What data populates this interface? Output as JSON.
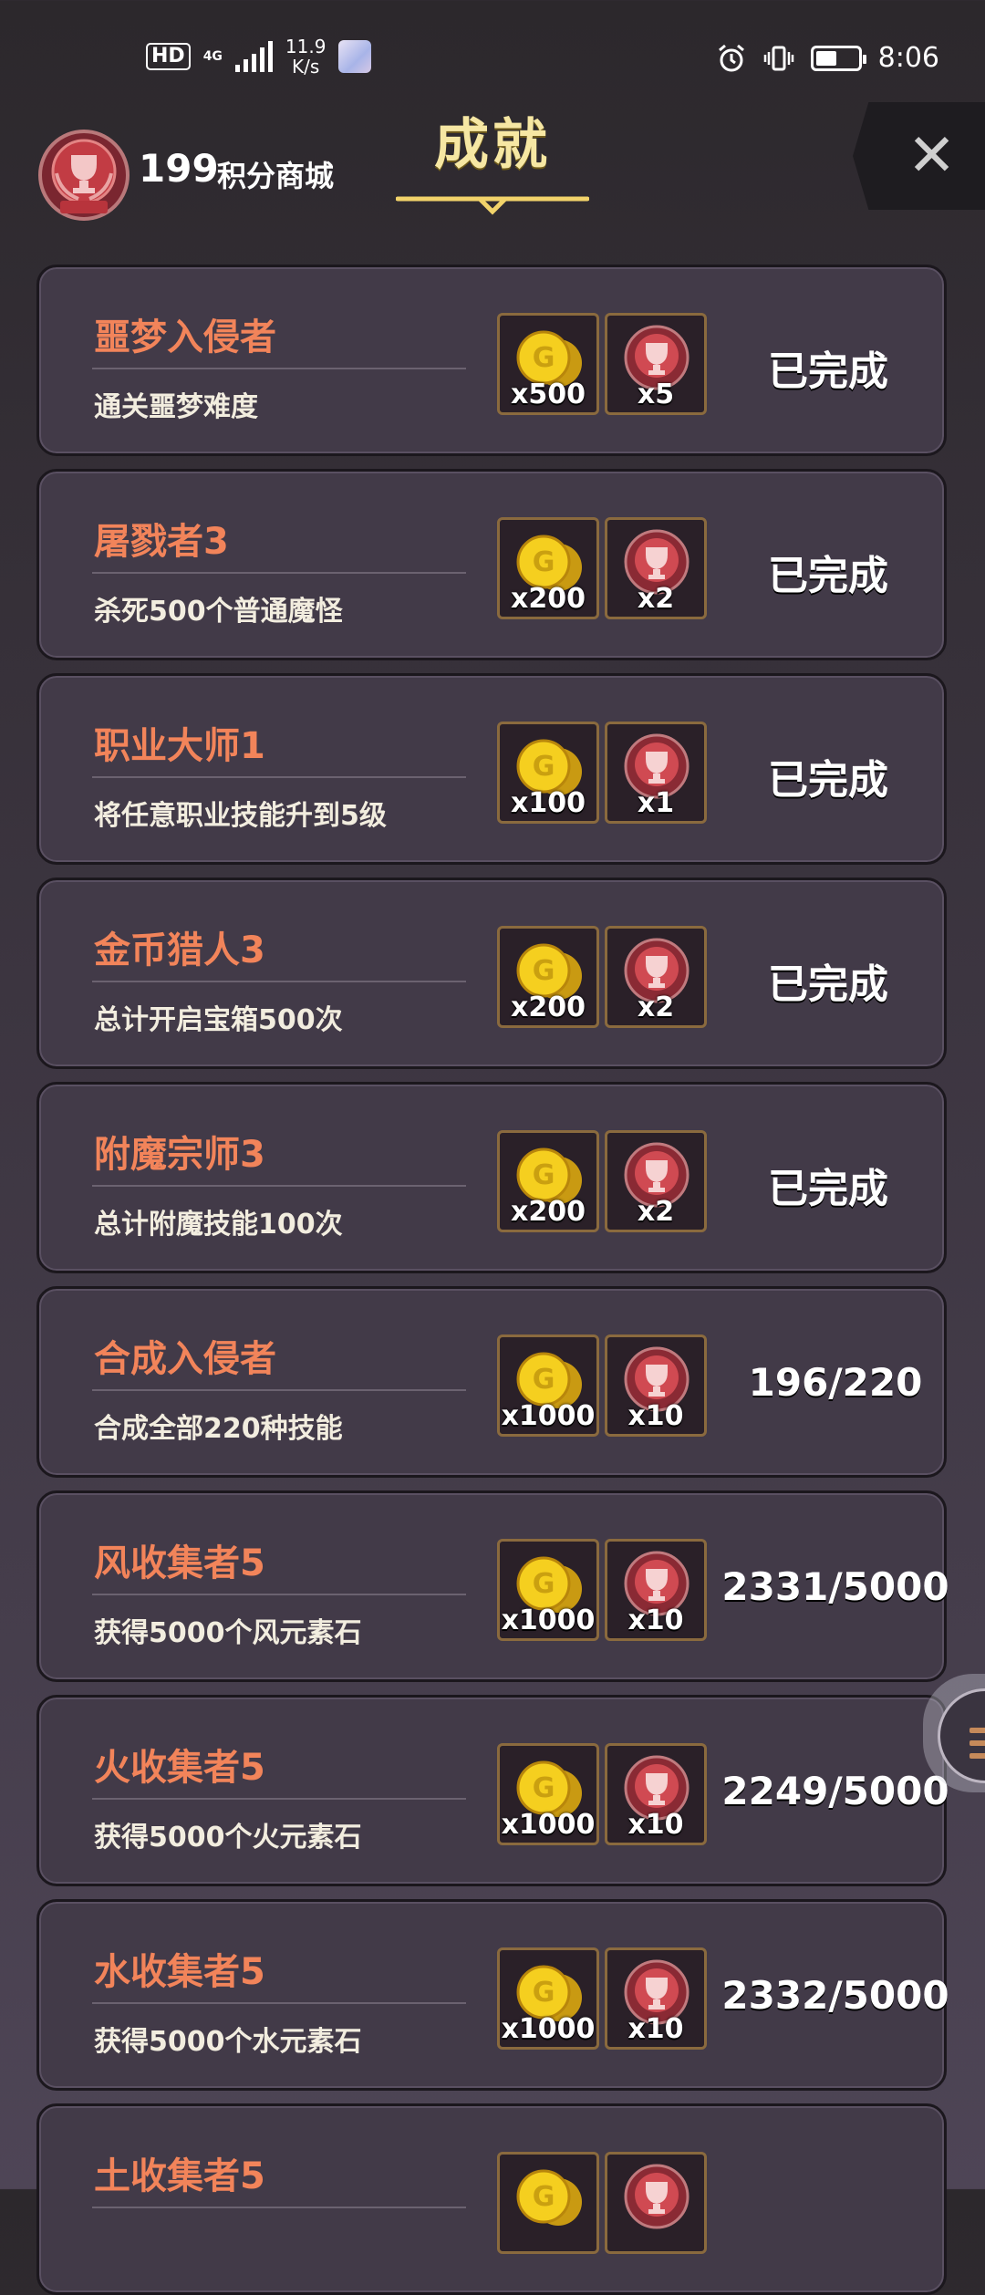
{
  "status_bar": {
    "hd": "HD",
    "network": "4G",
    "speed_value": "11.9",
    "speed_unit": "K/s",
    "time": "8:06",
    "battery_level": 0.5
  },
  "header": {
    "points": "199",
    "shop_label": "积分商城",
    "title": "成就",
    "close_icon": "close-icon"
  },
  "colors": {
    "name": "#f2845a",
    "desc": "#f2eddf",
    "title": "#f6e7a3",
    "card_bg": "#423a48"
  },
  "achievements": [
    {
      "name": "噩梦入侵者",
      "desc": "通关噩梦难度",
      "coin_qty": "x500",
      "medal_qty": "x5",
      "status": "已完成"
    },
    {
      "name": "屠戮者3",
      "desc": "杀死500个普通魔怪",
      "coin_qty": "x200",
      "medal_qty": "x2",
      "status": "已完成"
    },
    {
      "name": "职业大师1",
      "desc": "将任意职业技能升到5级",
      "coin_qty": "x100",
      "medal_qty": "x1",
      "status": "已完成"
    },
    {
      "name": "金币猎人3",
      "desc": "总计开启宝箱500次",
      "coin_qty": "x200",
      "medal_qty": "x2",
      "status": "已完成"
    },
    {
      "name": "附魔宗师3",
      "desc": "总计附魔技能100次",
      "coin_qty": "x200",
      "medal_qty": "x2",
      "status": "已完成"
    },
    {
      "name": "合成入侵者",
      "desc": "合成全部220种技能",
      "coin_qty": "x1000",
      "medal_qty": "x10",
      "status": "196/220"
    },
    {
      "name": "风收集者5",
      "desc": "获得5000个风元素石",
      "coin_qty": "x1000",
      "medal_qty": "x10",
      "status": "2331/5000"
    },
    {
      "name": "火收集者5",
      "desc": "获得5000个火元素石",
      "coin_qty": "x1000",
      "medal_qty": "x10",
      "status": "2249/5000"
    },
    {
      "name": "水收集者5",
      "desc": "获得5000个水元素石",
      "coin_qty": "x1000",
      "medal_qty": "x10",
      "status": "2332/5000"
    },
    {
      "name": "土收集者5",
      "desc": "",
      "coin_qty": "",
      "medal_qty": "",
      "status": ""
    }
  ]
}
